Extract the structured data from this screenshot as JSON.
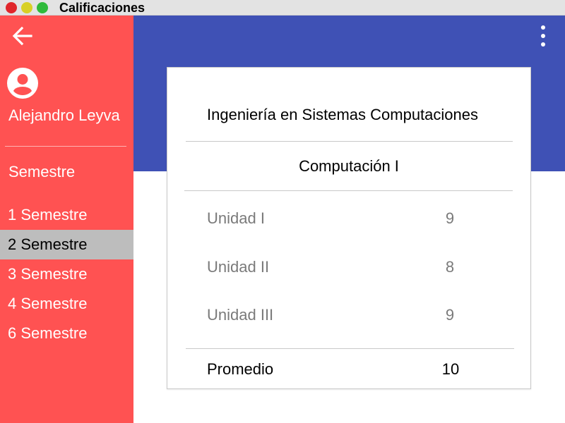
{
  "window": {
    "title": "Calificaciones"
  },
  "colors": {
    "sidebar": "#ff5252",
    "header": "#3f51b5",
    "active_item": "#bdbdbd"
  },
  "sidebar": {
    "back_icon": "arrow-left-icon",
    "avatar_icon": "account-circle-icon",
    "user_name": "Alejandro Leyva",
    "heading": "Semestre",
    "items": [
      {
        "label": "1 Semestre",
        "active": false
      },
      {
        "label": "2 Semestre",
        "active": true
      },
      {
        "label": "3 Semestre",
        "active": false
      },
      {
        "label": "4 Semestre",
        "active": false
      },
      {
        "label": "6 Semestre",
        "active": false
      }
    ]
  },
  "header": {
    "menu_icon": "more-vertical-icon"
  },
  "card": {
    "career": "Ingeniería en Sistemas Computaciones",
    "subject": "Computación I",
    "units": [
      {
        "name": "Unidad I",
        "grade": "9"
      },
      {
        "name": "Unidad II",
        "grade": "8"
      },
      {
        "name": "Unidad III",
        "grade": "9"
      }
    ],
    "average_label": "Promedio",
    "average_value": "10"
  }
}
